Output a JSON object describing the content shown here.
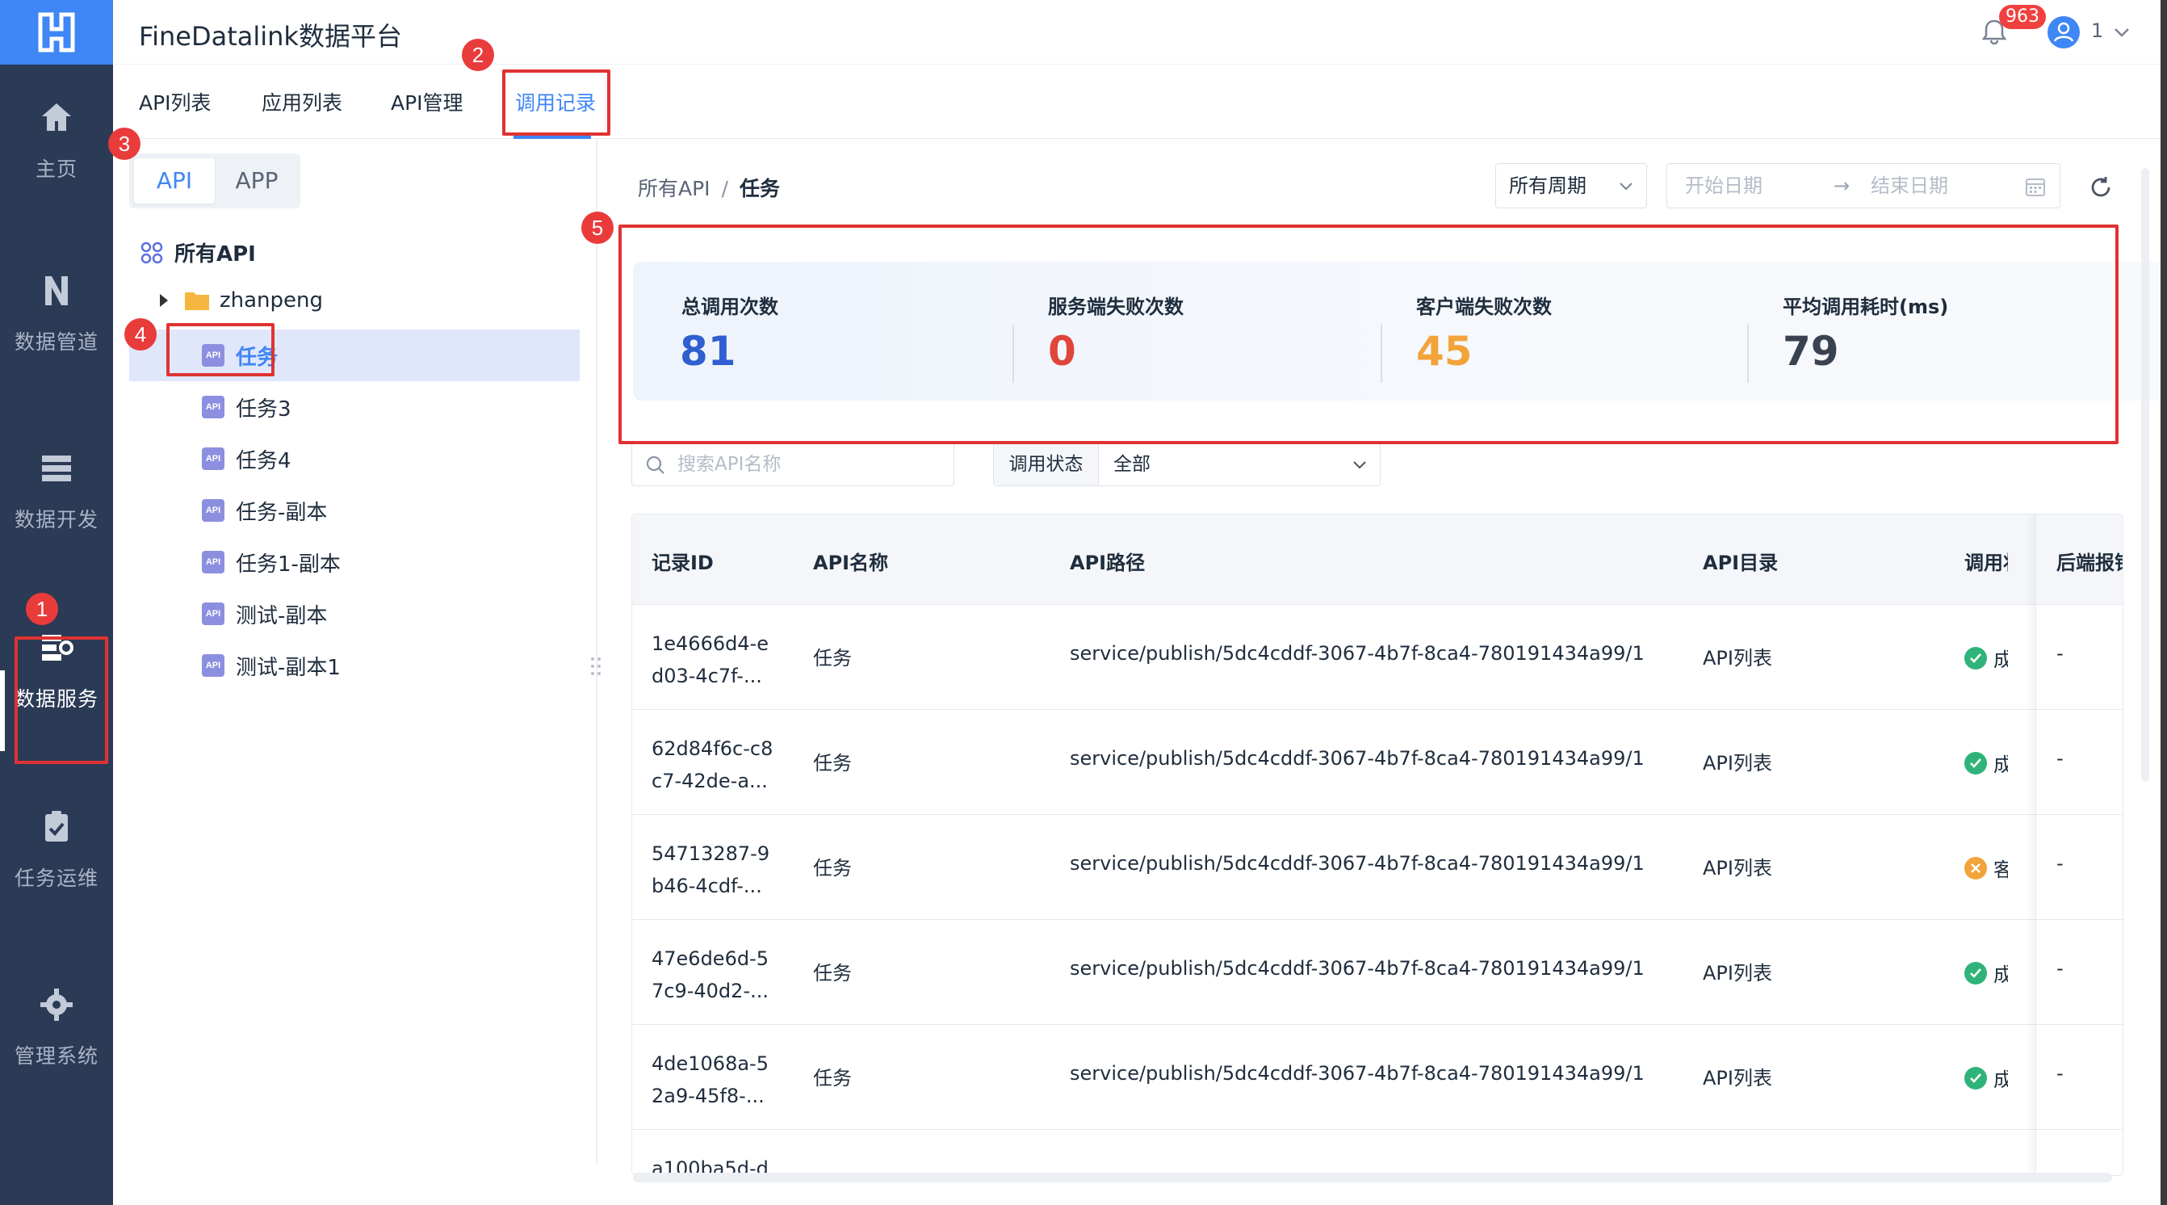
{
  "app": {
    "title": "FineDatalink数据平台",
    "notification_count": "963",
    "user_name": "1"
  },
  "rail": {
    "items": [
      {
        "label": "主页",
        "icon": "home-icon"
      },
      {
        "label": "数据管道",
        "icon": "pipeline-icon"
      },
      {
        "label": "数据开发",
        "icon": "dev-icon"
      },
      {
        "label": "数据服务",
        "icon": "service-icon",
        "active": true
      },
      {
        "label": "任务运维",
        "icon": "task-ops-icon"
      },
      {
        "label": "管理系统",
        "icon": "gear-icon"
      }
    ]
  },
  "tabs": [
    {
      "label": "API列表"
    },
    {
      "label": "应用列表"
    },
    {
      "label": "API管理"
    },
    {
      "label": "调用记录",
      "active": true
    }
  ],
  "annotations": [
    "1",
    "2",
    "3",
    "4",
    "5"
  ],
  "tree": {
    "segments": [
      "API",
      "APP"
    ],
    "root_label": "所有API",
    "folder_label": "zhanpeng",
    "api_icon_text": "API",
    "nodes": [
      "任务",
      "任务3",
      "任务4",
      "任务-副本",
      "任务1-副本",
      "测试-副本",
      "测试-副本1"
    ],
    "selected": "任务"
  },
  "breadcrumb": {
    "root": "所有API",
    "sep": "/",
    "current": "任务"
  },
  "filters": {
    "period": "所有周期",
    "start_placeholder": "开始日期",
    "arrow": "→",
    "end_placeholder": "结束日期",
    "search_placeholder": "搜索API名称",
    "status_label": "调用状态",
    "status_value": "全部"
  },
  "stats": [
    {
      "title": "总调用次数",
      "value": "81",
      "color": "#2f5fd0"
    },
    {
      "title": "服务端失败次数",
      "value": "0",
      "color": "#e0453a"
    },
    {
      "title": "客户端失败次数",
      "value": "45",
      "color": "#f2a33a"
    },
    {
      "title": "平均调用耗时(ms)",
      "value": "79",
      "color": "#3a4250"
    }
  ],
  "table": {
    "headers": [
      "记录ID",
      "API名称",
      "API路径",
      "API目录",
      "调用状",
      "后端报错"
    ],
    "rows": [
      {
        "id": "1e4666d4-e d03-4c7f-...",
        "name": "任务",
        "path": "service/publish/5dc4cddf-3067-4b7f-8ca4-780191434a99/1",
        "dir": "API列表",
        "status": "ok",
        "status_text": "成",
        "error": "-"
      },
      {
        "id": "62d84f6c-c8 c7-42de-a...",
        "name": "任务",
        "path": "service/publish/5dc4cddf-3067-4b7f-8ca4-780191434a99/1",
        "dir": "API列表",
        "status": "ok",
        "status_text": "成",
        "error": "-"
      },
      {
        "id": "54713287-9 b46-4cdf-...",
        "name": "任务",
        "path": "service/publish/5dc4cddf-3067-4b7f-8ca4-780191434a99/1",
        "dir": "API列表",
        "status": "fail",
        "status_text": "客",
        "error": "-"
      },
      {
        "id": "47e6de6d-5 7c9-40d2-...",
        "name": "任务",
        "path": "service/publish/5dc4cddf-3067-4b7f-8ca4-780191434a99/1",
        "dir": "API列表",
        "status": "ok",
        "status_text": "成",
        "error": "-"
      },
      {
        "id": "4de1068a-5 2a9-45f8-...",
        "name": "任务",
        "path": "service/publish/5dc4cddf-3067-4b7f-8ca4-780191434a99/1",
        "dir": "API列表",
        "status": "ok",
        "status_text": "成",
        "error": "-"
      },
      {
        "id": "a100ba5d-d",
        "name": "",
        "path": "",
        "dir": "",
        "status": "",
        "status_text": "",
        "error": ""
      }
    ]
  }
}
